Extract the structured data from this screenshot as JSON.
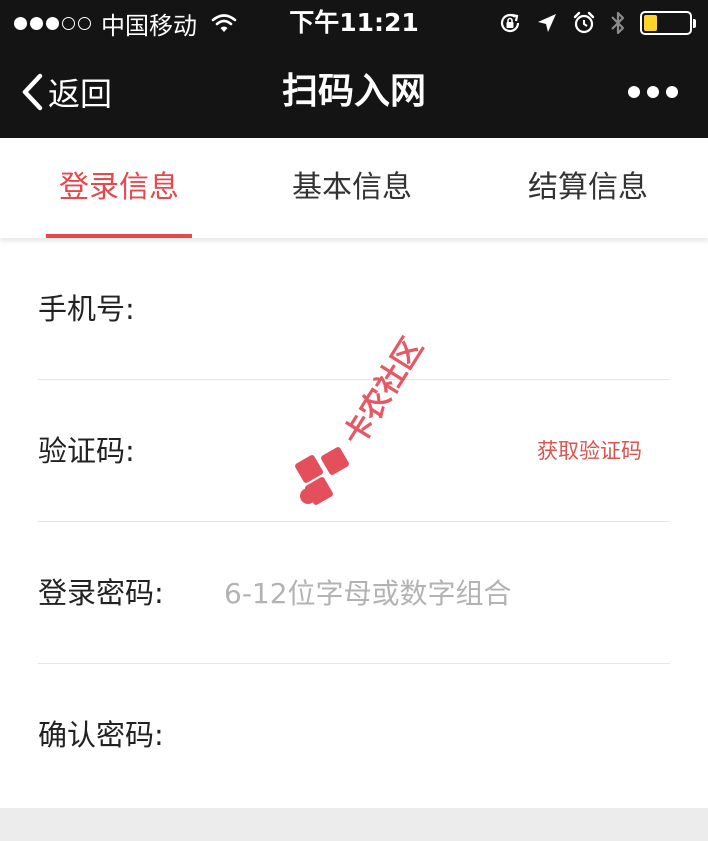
{
  "status_bar": {
    "signal_filled": 3,
    "signal_total": 5,
    "carrier": "中国移动",
    "time": "下午11:21",
    "battery_level": 0.3,
    "battery_color": "#ffd42a",
    "icons": [
      "wifi-icon",
      "rotation-lock-icon",
      "location-arrow-icon",
      "alarm-clock-icon",
      "bluetooth-icon",
      "battery-icon"
    ]
  },
  "nav": {
    "back_label": "返回",
    "title": "扫码入网",
    "more_icon": "more-dots-icon"
  },
  "tabs": [
    {
      "label": "登录信息",
      "active": true
    },
    {
      "label": "基本信息",
      "active": false
    },
    {
      "label": "结算信息",
      "active": false
    }
  ],
  "form": {
    "phone": {
      "label": "手机号:",
      "value": "",
      "placeholder": ""
    },
    "code": {
      "label": "验证码:",
      "value": "",
      "placeholder": "",
      "button": "获取验证码"
    },
    "password": {
      "label": "登录密码:",
      "value": "",
      "placeholder": "6-12位字母或数字组合"
    },
    "confirm": {
      "label": "确认密码:",
      "value": "",
      "placeholder": ""
    }
  },
  "watermark": {
    "text": "卡农社区"
  },
  "colors": {
    "accent": "#e5484d",
    "header_bg": "#141414",
    "placeholder": "#b3b3b3"
  }
}
